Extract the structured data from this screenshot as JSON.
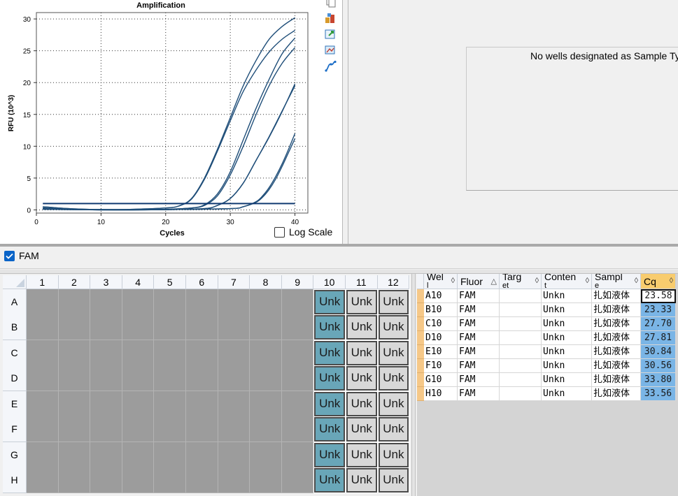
{
  "chart": {
    "title": "Amplification",
    "ylabel": "RFU (10^3)",
    "xlabel": "Cycles",
    "log_scale_label": "Log Scale",
    "log_scale_checked": false,
    "line_color": "#1f4e79"
  },
  "chart_data": {
    "type": "line",
    "title": "Amplification",
    "xlabel": "Cycles",
    "ylabel": "RFU (10^3)",
    "xlim": [
      0,
      42
    ],
    "ylim": [
      -0.5,
      31
    ],
    "x_ticks": [
      0,
      10,
      20,
      30,
      40
    ],
    "y_ticks": [
      0,
      5,
      10,
      15,
      20,
      25,
      30
    ],
    "grid": "dotted",
    "series": [
      {
        "x": [
          1,
          5,
          10,
          15,
          20,
          22,
          24,
          26,
          28,
          30,
          32,
          34,
          36,
          38,
          40
        ],
        "y": [
          0.3,
          0.1,
          0.05,
          0.1,
          0.3,
          0.6,
          1.8,
          5.0,
          9.5,
          14.5,
          19.5,
          23.5,
          26.8,
          28.8,
          30.2
        ]
      },
      {
        "x": [
          1,
          5,
          10,
          15,
          20,
          22,
          24,
          26,
          28,
          30,
          32,
          34,
          36,
          38,
          40
        ],
        "y": [
          0.3,
          0.1,
          0.05,
          0.1,
          0.3,
          0.6,
          1.7,
          4.8,
          9.2,
          14.0,
          18.6,
          22.0,
          24.8,
          26.8,
          28.2
        ]
      },
      {
        "x": [
          1,
          5,
          10,
          15,
          20,
          24,
          26,
          28,
          30,
          32,
          34,
          36,
          38,
          40
        ],
        "y": [
          0.5,
          0.2,
          0.05,
          0.05,
          0.1,
          0.3,
          0.8,
          2.5,
          6.0,
          11.0,
          16.0,
          20.5,
          24.5,
          27.0
        ]
      },
      {
        "x": [
          1,
          5,
          10,
          15,
          20,
          24,
          26,
          28,
          30,
          32,
          34,
          36,
          38,
          40
        ],
        "y": [
          0.5,
          0.2,
          0.05,
          0.05,
          0.1,
          0.3,
          0.7,
          2.2,
          5.5,
          10.0,
          15.0,
          19.5,
          23.0,
          25.5
        ]
      },
      {
        "x": [
          1,
          10,
          20,
          26,
          28,
          30,
          32,
          34,
          36,
          38,
          40
        ],
        "y": [
          0.2,
          0.0,
          0.05,
          0.2,
          0.7,
          1.8,
          4.2,
          7.8,
          11.5,
          15.5,
          19.5
        ]
      },
      {
        "x": [
          1,
          10,
          20,
          26,
          28,
          30,
          32,
          34,
          36,
          38,
          40
        ],
        "y": [
          0.2,
          0.0,
          0.05,
          0.2,
          0.7,
          1.8,
          4.2,
          7.8,
          11.4,
          15.4,
          19.8
        ]
      },
      {
        "x": [
          1,
          10,
          20,
          30,
          32,
          34,
          35,
          36,
          37,
          38,
          39,
          40
        ],
        "y": [
          0.1,
          0.0,
          0.05,
          0.2,
          0.5,
          1.3,
          2.2,
          3.5,
          5.2,
          7.2,
          9.5,
          12.0
        ]
      },
      {
        "x": [
          1,
          10,
          20,
          30,
          32,
          34,
          35,
          36,
          37,
          38,
          39,
          40
        ],
        "y": [
          0.1,
          0.0,
          0.05,
          0.2,
          0.5,
          1.2,
          2.0,
          3.2,
          4.8,
          6.8,
          9.0,
          11.2
        ]
      },
      {
        "x": [
          1,
          40
        ],
        "y": [
          1.0,
          1.0
        ],
        "role": "threshold"
      }
    ]
  },
  "toolbar_icons": [
    "copy-icon",
    "plate-export-icon",
    "export-chart-icon",
    "chart-settings-icon",
    "curve-fit-icon"
  ],
  "sample_panel": {
    "message": "No wells designated as Sample Ty"
  },
  "fluor_filter": {
    "label": "FAM",
    "checked": true
  },
  "plate": {
    "columns": [
      "1",
      "2",
      "3",
      "4",
      "5",
      "6",
      "7",
      "8",
      "9",
      "10",
      "11",
      "12"
    ],
    "rows": [
      "A",
      "B",
      "C",
      "D",
      "E",
      "F",
      "G",
      "H"
    ],
    "well_label": "Unk",
    "selected_color": "#69a6b8",
    "empty_color": "#9c9c9c"
  },
  "table": {
    "headers": [
      {
        "top": "Wel",
        "bottom": "l"
      },
      {
        "top": "Fluor",
        "bottom": ""
      },
      {
        "top": "Targ",
        "bottom": "et"
      },
      {
        "top": "Conten",
        "bottom": "t"
      },
      {
        "top": "Sampl",
        "bottom": "e"
      },
      {
        "top": "Cq",
        "bottom": ""
      }
    ],
    "rows": [
      {
        "well": "A10",
        "fluor": "FAM",
        "target": "",
        "content": "Unkn",
        "sample": "扎如液体",
        "cq": "23.58"
      },
      {
        "well": "B10",
        "fluor": "FAM",
        "target": "",
        "content": "Unkn",
        "sample": "扎如液体",
        "cq": "23.33"
      },
      {
        "well": "C10",
        "fluor": "FAM",
        "target": "",
        "content": "Unkn",
        "sample": "扎如液体",
        "cq": "27.70"
      },
      {
        "well": "D10",
        "fluor": "FAM",
        "target": "",
        "content": "Unkn",
        "sample": "扎如液体",
        "cq": "27.81"
      },
      {
        "well": "E10",
        "fluor": "FAM",
        "target": "",
        "content": "Unkn",
        "sample": "扎如液体",
        "cq": "30.84"
      },
      {
        "well": "F10",
        "fluor": "FAM",
        "target": "",
        "content": "Unkn",
        "sample": "扎如液体",
        "cq": "30.56"
      },
      {
        "well": "G10",
        "fluor": "FAM",
        "target": "",
        "content": "Unkn",
        "sample": "扎如液体",
        "cq": "33.80"
      },
      {
        "well": "H10",
        "fluor": "FAM",
        "target": "",
        "content": "Unkn",
        "sample": "扎如液体",
        "cq": "33.56"
      }
    ]
  }
}
